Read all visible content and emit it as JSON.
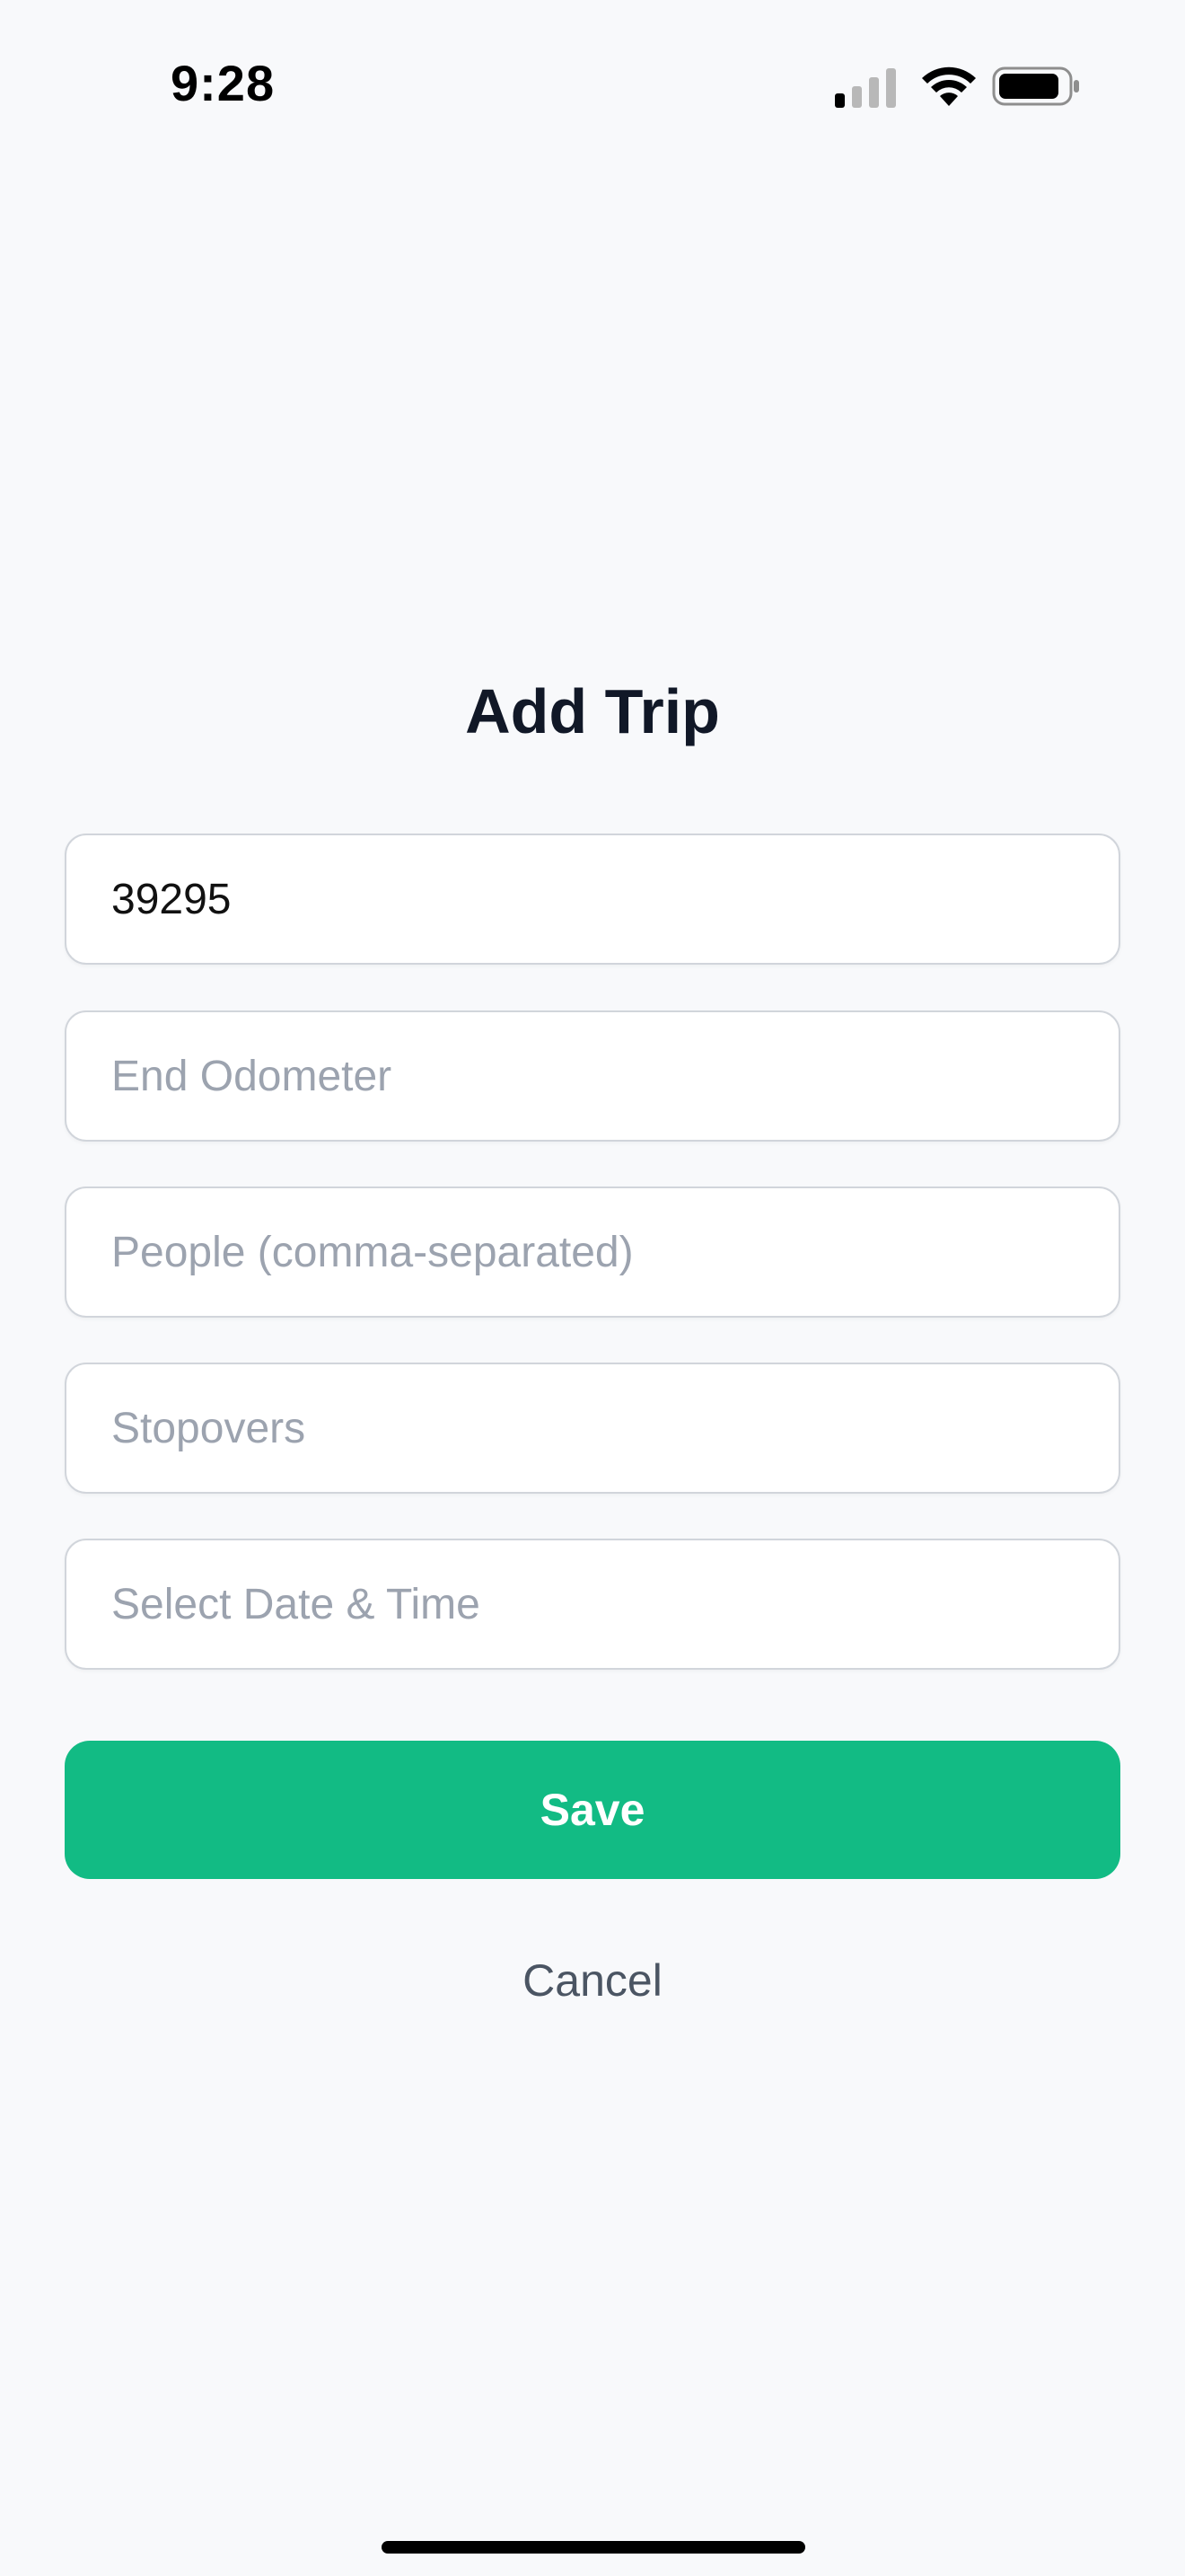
{
  "status_bar": {
    "time": "9:28",
    "icons": [
      "cellular-signal-icon",
      "wifi-icon",
      "battery-icon"
    ]
  },
  "page": {
    "title": "Add Trip"
  },
  "form": {
    "start_odometer": {
      "value": "39295",
      "placeholder": ""
    },
    "end_odometer": {
      "value": "",
      "placeholder": "End Odometer"
    },
    "people": {
      "value": "",
      "placeholder": "People (comma-separated)"
    },
    "stopovers": {
      "value": "",
      "placeholder": "Stopovers"
    },
    "date_time": {
      "value": "",
      "placeholder": "Select Date & Time"
    }
  },
  "actions": {
    "save_label": "Save",
    "cancel_label": "Cancel"
  },
  "colors": {
    "background": "#f8f9fb",
    "accent": "#12bb84",
    "title": "#111827",
    "placeholder": "#9ca3af",
    "cancel_text": "#4b5563"
  }
}
